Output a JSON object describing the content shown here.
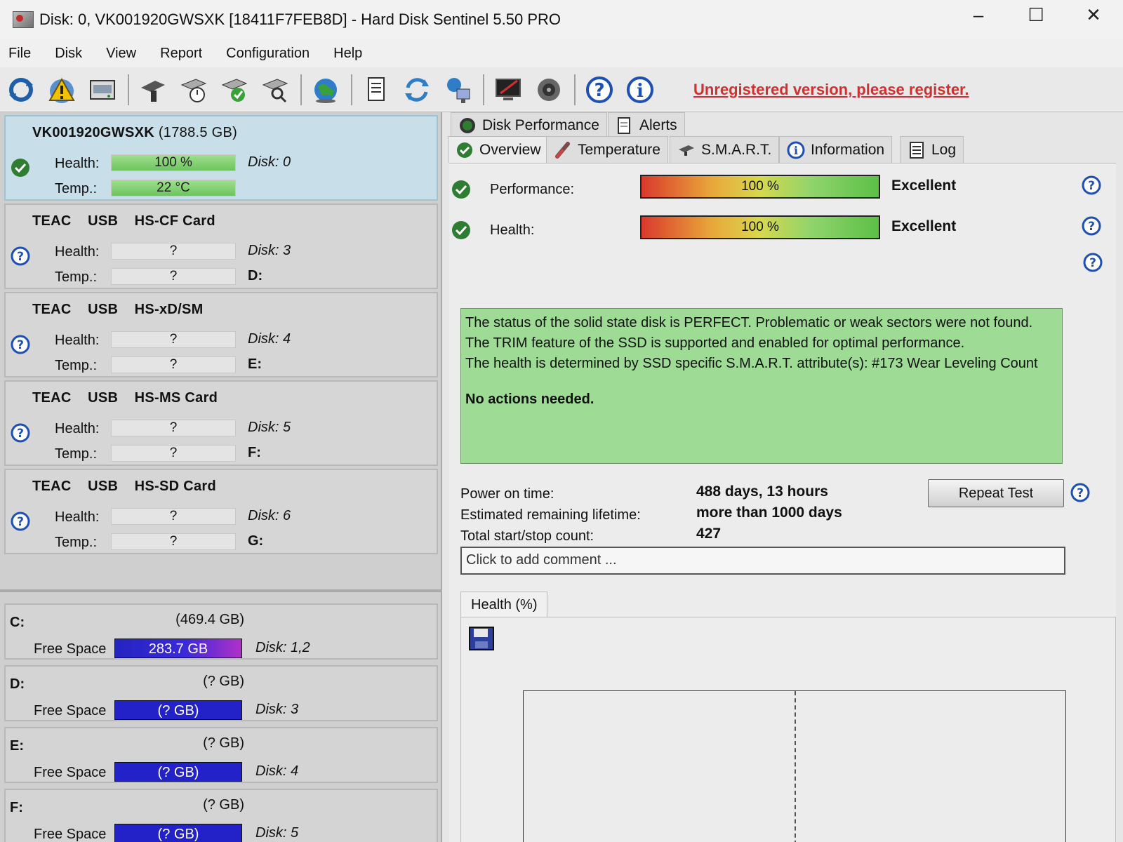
{
  "window": {
    "title": "Disk: 0, VK001920GWSXK [18411F7FEB8D]  -  Hard Disk Sentinel 5.50 PRO",
    "controls": {
      "minimize": "–",
      "maximize": "☐",
      "close": "✕"
    }
  },
  "menu": [
    "File",
    "Disk",
    "View",
    "Report",
    "Configuration",
    "Help"
  ],
  "toolbar": {
    "register_text": "Unregistered version, please register.",
    "icons": [
      "refresh-icon",
      "alert-icon",
      "disk-icon",
      "disk-tools-icon",
      "disk-clock-icon",
      "disk-check-icon",
      "disk-search-icon",
      "globe-icon",
      "report-icon",
      "sync-icon",
      "network-icon",
      "monitor-icon",
      "speaker-icon",
      "help-icon",
      "info-icon"
    ]
  },
  "disks": [
    {
      "name": "VK001920GWSXK",
      "size": "(1788.5 GB)",
      "health_label": "Health:",
      "health": "100 %",
      "temp_label": "Temp.:",
      "temp": "22 °C",
      "disk": "Disk: 0",
      "letter": "",
      "status": "ok",
      "health_fraction": 1.0
    },
    {
      "name": "TEAC    USB    HS-CF Card",
      "size": "",
      "health_label": "Health:",
      "health": "?",
      "temp_label": "Temp.:",
      "temp": "?",
      "disk": "Disk: 3",
      "letter": "D:",
      "status": "unknown"
    },
    {
      "name": "TEAC    USB    HS-xD/SM",
      "size": "",
      "health_label": "Health:",
      "health": "?",
      "temp_label": "Temp.:",
      "temp": "?",
      "disk": "Disk: 4",
      "letter": "E:",
      "status": "unknown"
    },
    {
      "name": "TEAC    USB    HS-MS Card",
      "size": "",
      "health_label": "Health:",
      "health": "?",
      "temp_label": "Temp.:",
      "temp": "?",
      "disk": "Disk: 5",
      "letter": "F:",
      "status": "unknown"
    },
    {
      "name": "TEAC    USB    HS-SD Card",
      "size": "",
      "health_label": "Health:",
      "health": "?",
      "temp_label": "Temp.:",
      "temp": "?",
      "disk": "Disk: 6",
      "letter": "G:",
      "status": "unknown"
    }
  ],
  "volumes": [
    {
      "letter": "C:",
      "size": "(469.4 GB)",
      "label": "Free Space",
      "free": "283.7 GB",
      "disk": "Disk: 1,2"
    },
    {
      "letter": "D:",
      "size": "(? GB)",
      "label": "Free Space",
      "free": "(? GB)",
      "disk": "Disk: 3"
    },
    {
      "letter": "E:",
      "size": "(? GB)",
      "label": "Free Space",
      "free": "(? GB)",
      "disk": "Disk: 4"
    },
    {
      "letter": "F:",
      "size": "(? GB)",
      "label": "Free Space",
      "free": "(? GB)",
      "disk": "Disk: 5"
    }
  ],
  "tabs": {
    "top": [
      "Disk Performance",
      "Alerts"
    ],
    "bottom": [
      "Overview",
      "Temperature",
      "S.M.A.R.T.",
      "Information",
      "Log"
    ],
    "active": "Overview"
  },
  "overview": {
    "performance_label": "Performance:",
    "performance_value": "100 %",
    "performance_fraction": 1.0,
    "performance_rating": "Excellent",
    "health_label": "Health:",
    "health_value": "100 %",
    "health_fraction": 1.0,
    "health_rating": "Excellent",
    "status_lines": [
      "The status of the solid state disk is PERFECT. Problematic or weak sectors were not found.",
      "The TRIM feature of the SSD is supported and enabled for optimal performance.",
      "The health is determined by SSD specific S.M.A.R.T. attribute(s):  #173 Wear Leveling Count"
    ],
    "status_action": "No actions needed.",
    "power_on_label": "Power on time:",
    "power_on_value": "488 days, 13 hours",
    "lifetime_label": "Estimated remaining lifetime:",
    "lifetime_value": "more than 1000 days",
    "startstop_label": "Total start/stop count:",
    "startstop_value": "427",
    "repeat_button": "Repeat Test",
    "comment_placeholder": "Click to add comment ...",
    "chart_tab": "Health (%)"
  },
  "colors": {
    "status_ok": "#2e7d32",
    "status_unknown": "#1e4fb4",
    "register_link": "#d32f2f",
    "status_box": "#9edb95",
    "selected_card": "#c8dfe9"
  }
}
